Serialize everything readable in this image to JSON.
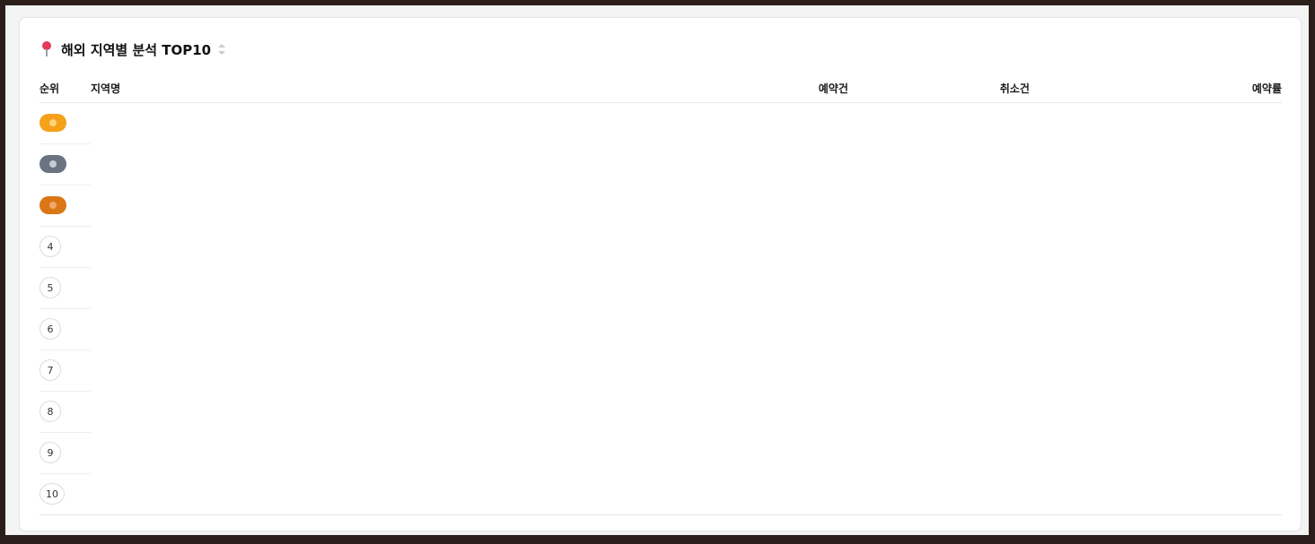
{
  "section": {
    "title": "해외 지역별 분석 TOP10",
    "icon": "pin-icon",
    "sort_icon": "sort-icon"
  },
  "table": {
    "headers": {
      "rank": "순위",
      "region": "지역명",
      "reservations": "예약건",
      "cancellations": "취소건",
      "rate": "예약률"
    },
    "rows": [
      {
        "rank": "1",
        "badge": "gold",
        "region": "",
        "reservations": "",
        "cancellations": "",
        "rate": ""
      },
      {
        "rank": "2",
        "badge": "silver",
        "region": "",
        "reservations": "",
        "cancellations": "",
        "rate": ""
      },
      {
        "rank": "3",
        "badge": "bronze",
        "region": "",
        "reservations": "",
        "cancellations": "",
        "rate": ""
      },
      {
        "rank": "4",
        "region": "",
        "reservations": "",
        "cancellations": "",
        "rate": ""
      },
      {
        "rank": "5",
        "region": "",
        "reservations": "",
        "cancellations": "",
        "rate": ""
      },
      {
        "rank": "6",
        "region": "",
        "reservations": "",
        "cancellations": "",
        "rate": ""
      },
      {
        "rank": "7",
        "region": "",
        "reservations": "",
        "cancellations": "",
        "rate": ""
      },
      {
        "rank": "8",
        "region": "",
        "reservations": "",
        "cancellations": "",
        "rate": ""
      },
      {
        "rank": "9",
        "region": "",
        "reservations": "",
        "cancellations": "",
        "rate": ""
      },
      {
        "rank": "10",
        "region": "",
        "reservations": "",
        "cancellations": "",
        "rate": ""
      }
    ]
  },
  "colors": {
    "gold": "#f5a11a",
    "silver": "#6b7280",
    "bronze": "#d97716",
    "cancel_text": "#e8787f"
  }
}
